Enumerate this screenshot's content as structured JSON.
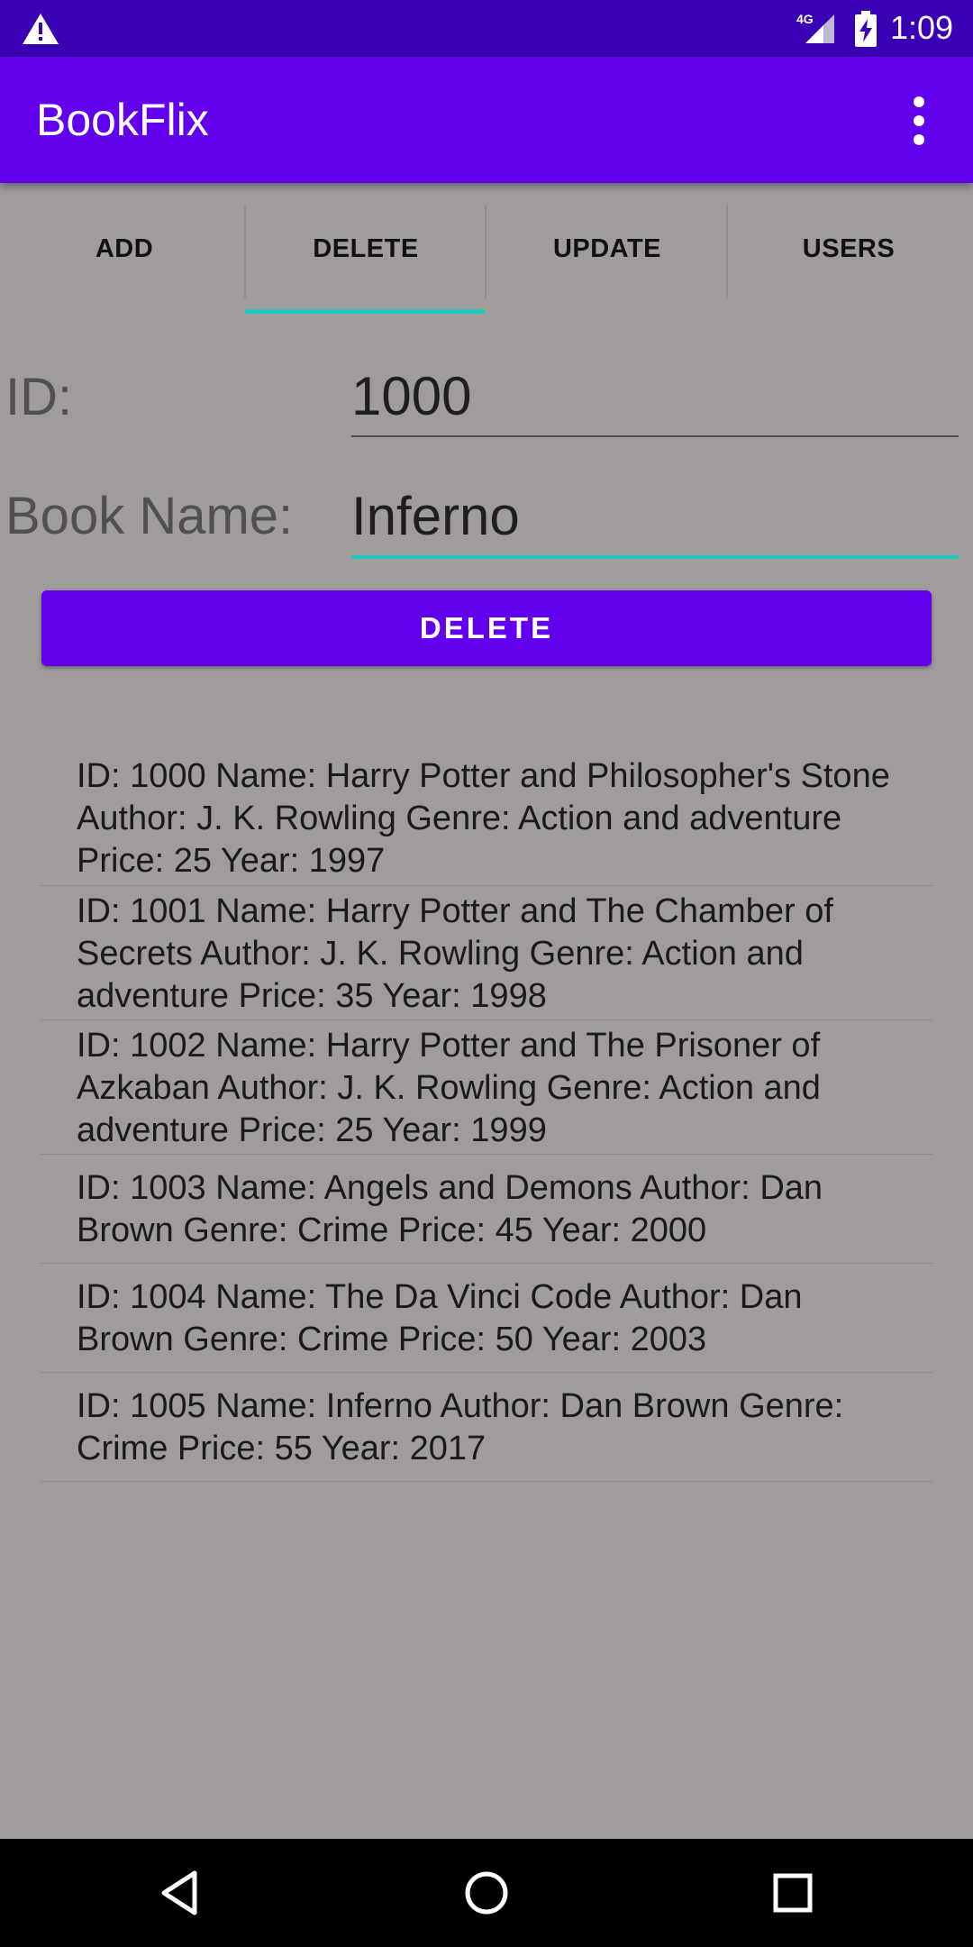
{
  "status_bar": {
    "time": "1:09",
    "network": "4G",
    "icons": [
      "alert-icon",
      "signal-icon",
      "battery-charging-icon"
    ]
  },
  "app_bar": {
    "title": "BookFlix",
    "menu_icon": "more-vert-icon"
  },
  "tabs": [
    {
      "label": "ADD",
      "selected": false
    },
    {
      "label": "DELETE",
      "selected": true
    },
    {
      "label": "UPDATE",
      "selected": false
    },
    {
      "label": "USERS",
      "selected": false
    }
  ],
  "form": {
    "id_label": "ID:",
    "id_value": "1000",
    "book_name_label": "Book Name:",
    "book_name_value": "Inferno",
    "delete_button": "DELETE"
  },
  "books": [
    "ID: 1000 Name: Harry Potter and Philosopher's Stone Author: J. K. Rowling Genre: Action and adventure Price: 25 Year: 1997",
    "ID: 1001 Name: Harry Potter and The Chamber of Secrets Author: J. K. Rowling Genre: Action and adventure Price: 35 Year: 1998",
    "ID: 1002 Name: Harry Potter and The Prisoner of Azkaban Author: J. K. Rowling Genre: Action and adventure Price: 25 Year: 1999",
    "ID: 1003 Name: Angels and Demons Author: Dan Brown Genre: Crime Price: 45 Year: 2000",
    "ID: 1004 Name: The Da Vinci Code Author: Dan Brown Genre: Crime Price: 50 Year: 2003",
    "ID: 1005 Name: Inferno Author: Dan Brown Genre: Crime Price: 55 Year: 2017"
  ],
  "nav_bar": {
    "icons": [
      "back-icon",
      "home-icon",
      "recents-icon"
    ]
  },
  "colors": {
    "status_bar": "#3a00b3",
    "primary": "#6200ee",
    "accent": "#1fc7bd",
    "background": "#9f9c9b"
  }
}
